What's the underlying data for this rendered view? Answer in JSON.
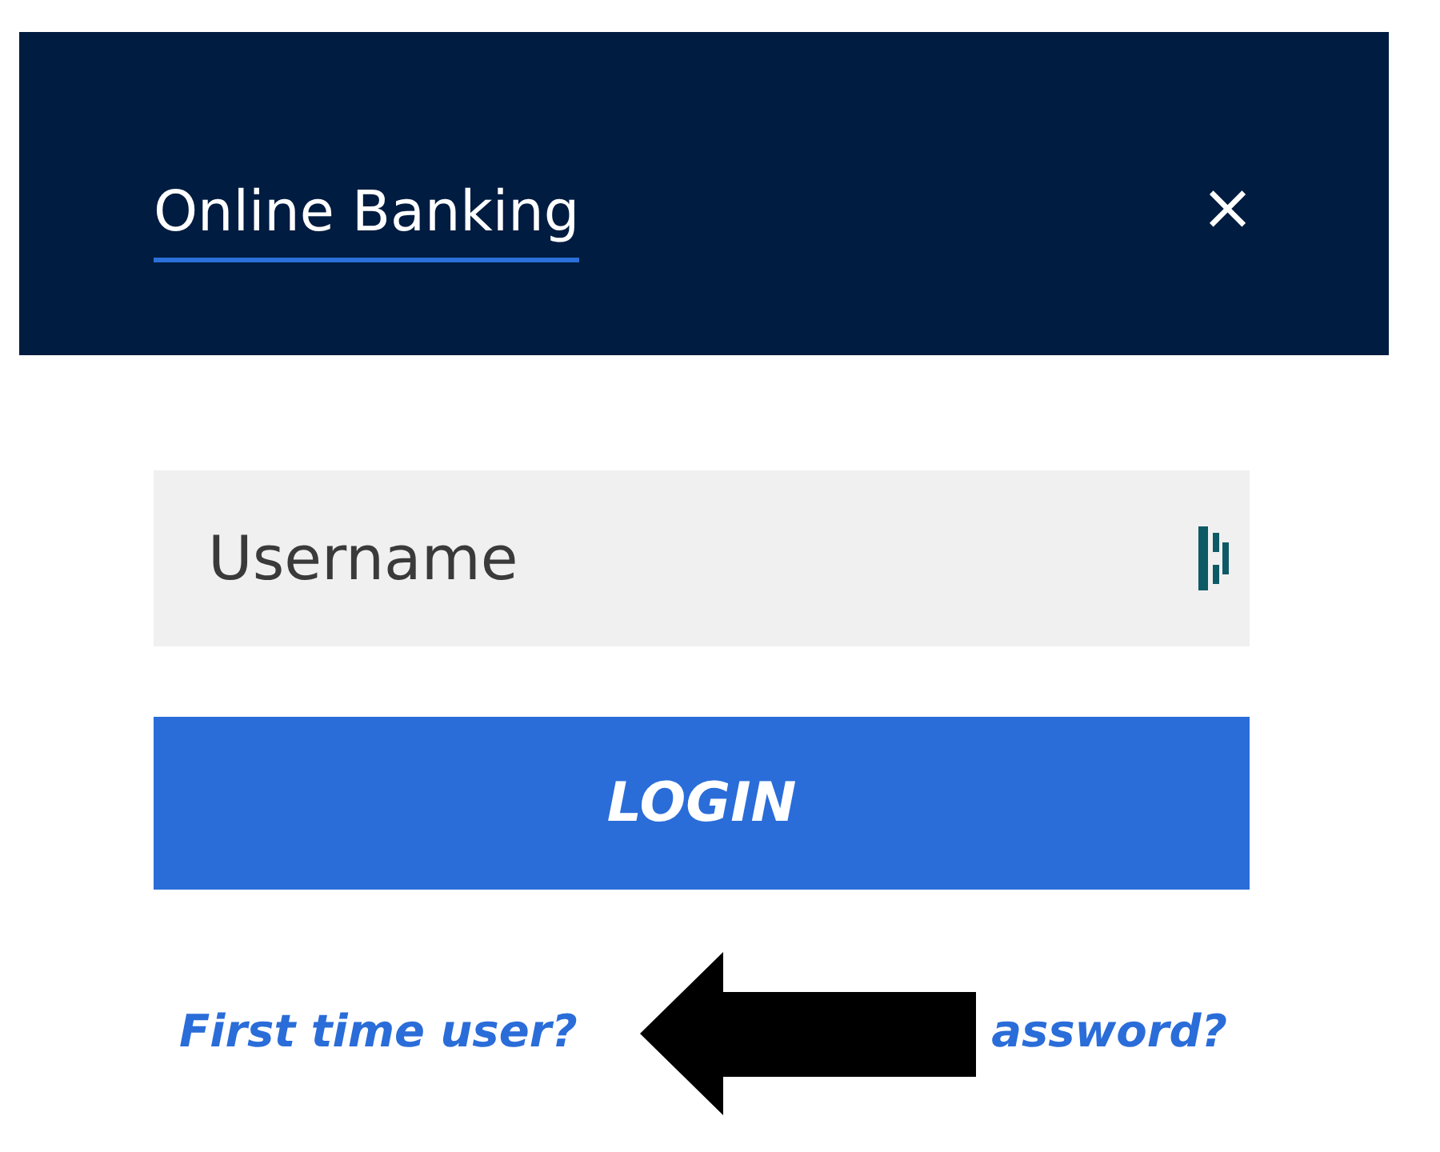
{
  "header": {
    "title": "Online Banking",
    "close": "×"
  },
  "username": {
    "placeholder": "Username"
  },
  "login_button": "LOGIN",
  "links": [
    "First time user?",
    "assword?"
  ]
}
